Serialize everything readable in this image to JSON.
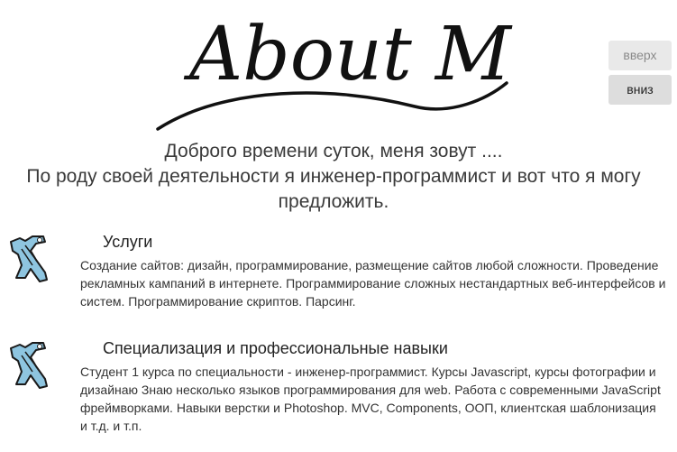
{
  "header": {
    "logo_text": "About Me"
  },
  "nav": {
    "up_label": "вверх",
    "down_label": "вниз"
  },
  "intro": {
    "line1": "Доброго времени суток, меня зовут ....",
    "line2": "По роду своей деятельности я инженер-программист и вот что я могу предложить."
  },
  "sections": [
    {
      "icon": "tools-icon",
      "title": "Услуги",
      "body": "Создание сайтов: дизайн, программирование, размещение сайтов любой сложности. Проведение рекламных кампаний в интернете. Программирование сложных нестандартных веб-интерфейсов и систем. Программирование скриптов. Парсинг."
    },
    {
      "icon": "tools-icon",
      "title": "Специализация и профессиональные навыки",
      "body": "Студент 1 курса по специальности - инженер-программист. Курсы Javascript, курсы фотографии и дизайнаю Знаю несколько языков программирования для web. Работа с современными JavaScript фреймворками. Навыки верстки и Photoshop. MVC, Components, ООП, клиентская шаблонизация и т.д. и т.п."
    }
  ],
  "colors": {
    "icon_fill": "#8ec5e0",
    "icon_stroke": "#1a1a1a",
    "button_bg": "#e4e4e4",
    "text": "#333333"
  }
}
